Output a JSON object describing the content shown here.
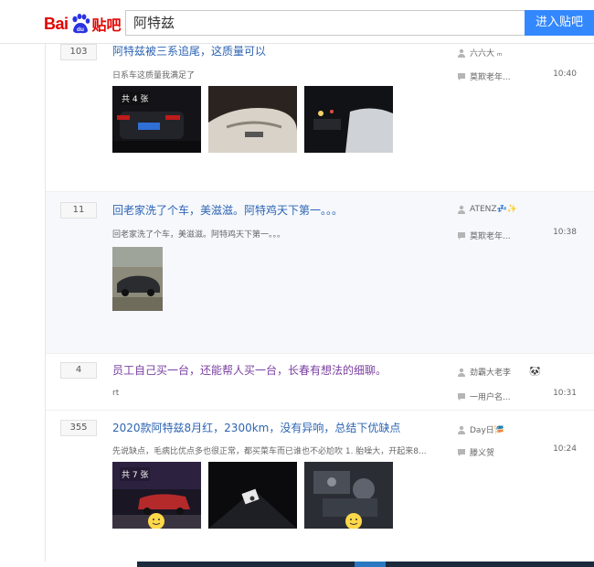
{
  "header": {
    "logo_text_left": "Bai",
    "logo_text_paw": "du",
    "logo_text_right": "贴吧",
    "search_value": "阿特兹",
    "enter_button": "进入贴吧"
  },
  "threads": [
    {
      "replies": "103",
      "title": "阿特兹被三系追尾，这质量可以",
      "abstract": "日系车这质量我满足了",
      "author": "六六大 ₘ",
      "last_reply_user": "莫欺老年...",
      "time": "10:40",
      "image_count": "共 4 张"
    },
    {
      "replies": "11",
      "title": "回老家洗了个车，美滋滋。阿特鸡天下第一。。。",
      "abstract": "回老家洗了个车，美滋滋。阿特鸡天下第一。。。",
      "author": "ATENZ💤✨",
      "last_reply_user": "莫欺老年...",
      "time": "10:38"
    },
    {
      "replies": "4",
      "title": "员工自己买一台，还能帮人买一台，长春有想法的细聊。",
      "abstract": "rt",
      "author": "劲霸大老李",
      "last_reply_user": "一用户名...",
      "time": "10:31"
    },
    {
      "replies": "355",
      "title": "2020款阿特兹8月红，2300km，没有异响，总结下优缺点",
      "abstract": "先说缺点，毛病比优点多也很正常，都买菜车而已谁也不必尬吹 1. 胎噪大，开起来8...",
      "author": "Day日🎏",
      "last_reply_user": "滕义贺",
      "time": "10:24",
      "image_count": "共 7 张"
    }
  ],
  "colors": {
    "brand_red": "#e10601",
    "link_blue": "#2d64b3",
    "visited_purple": "#7a3fa0",
    "button_blue": "#3388ff"
  }
}
